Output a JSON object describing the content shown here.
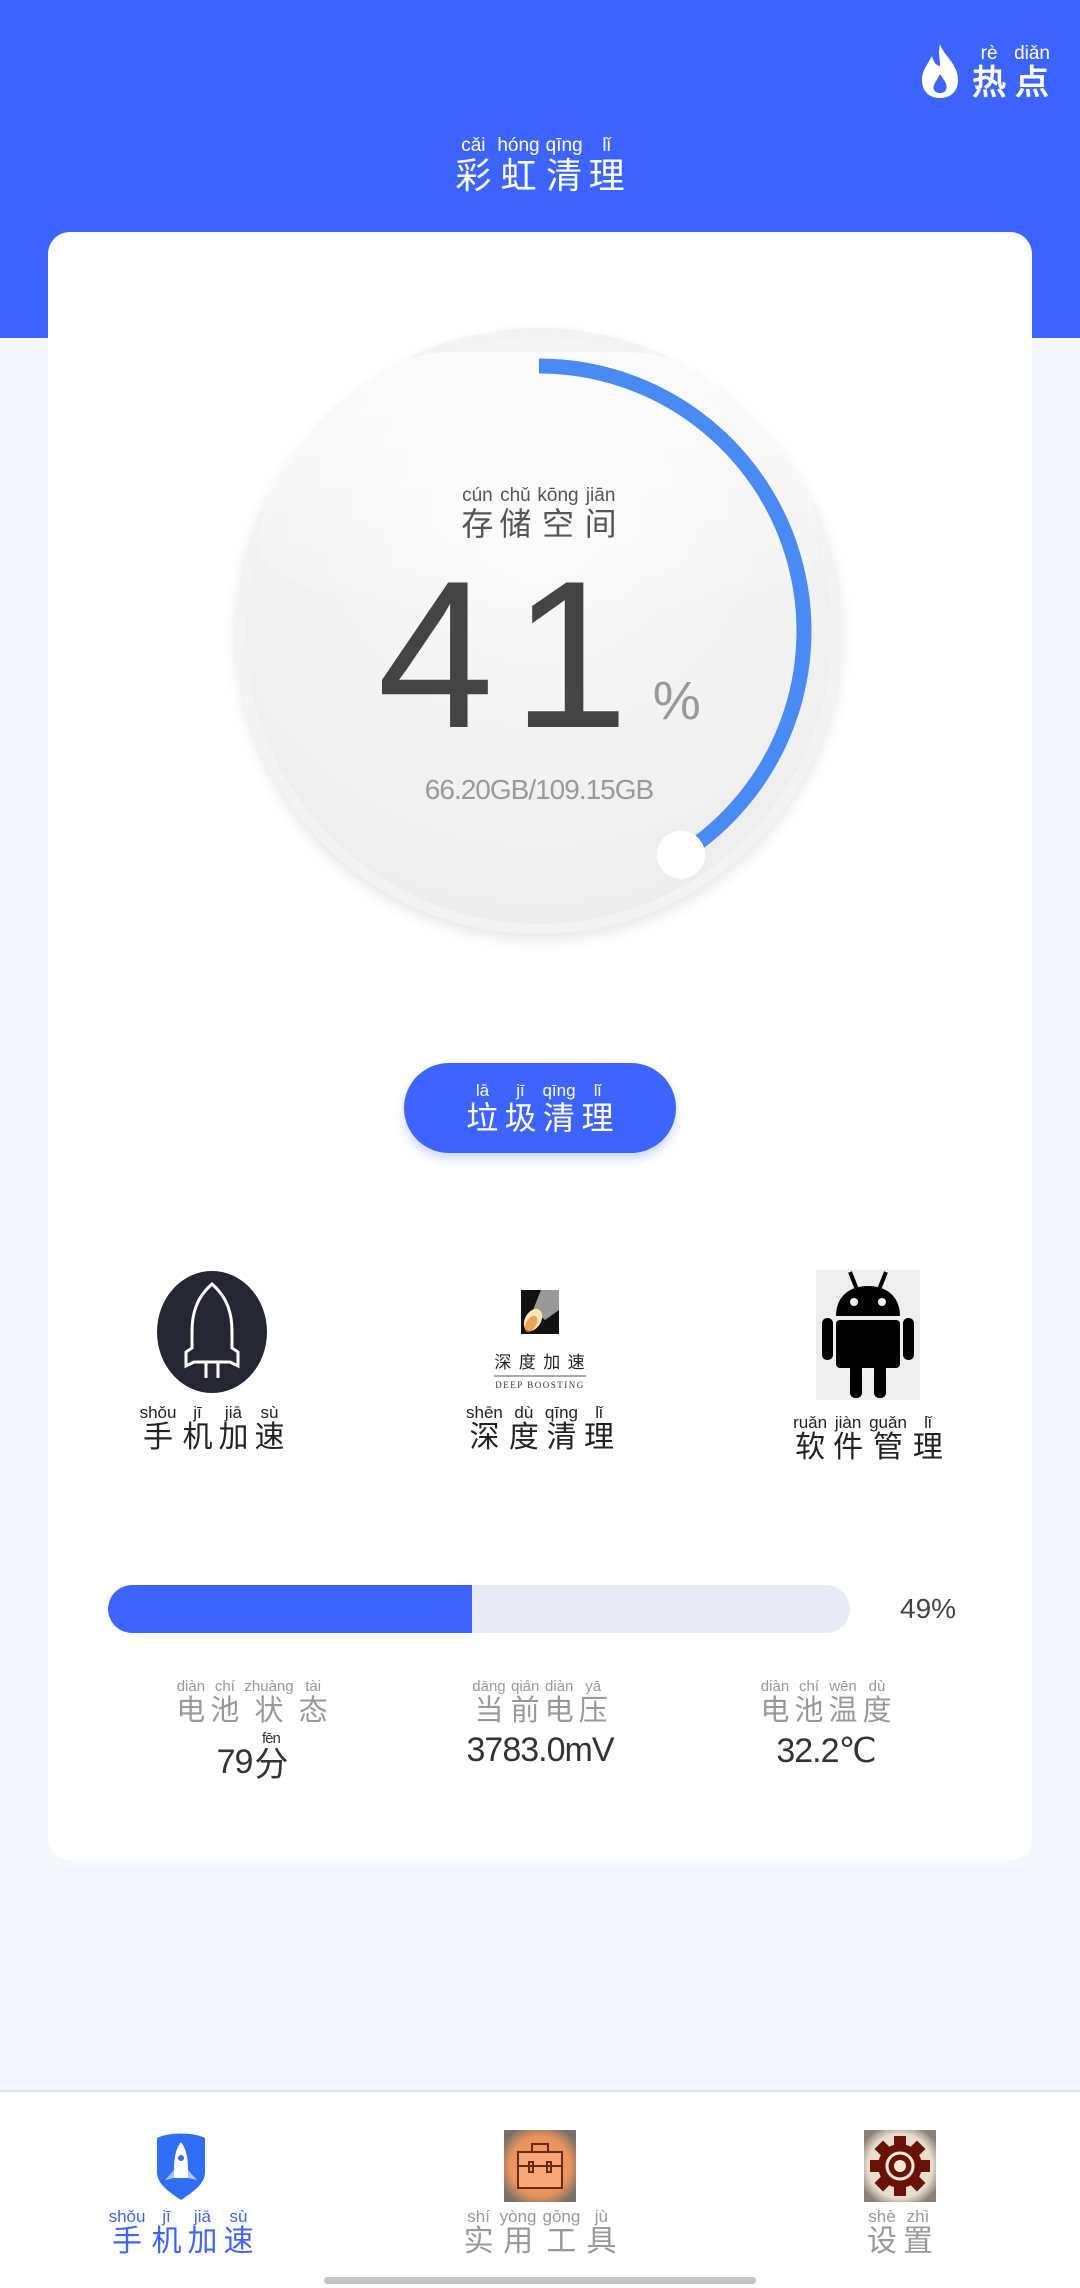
{
  "header": {
    "title": {
      "pinyin": [
        "cǎi",
        "hóng",
        "qīng",
        "lǐ"
      ],
      "hanzi": [
        "彩",
        "虹",
        "清",
        "理"
      ]
    },
    "hot": {
      "icon": "flame-icon",
      "pinyin": [
        "rè",
        "diǎn"
      ],
      "hanzi": [
        "热",
        "点"
      ]
    }
  },
  "storage": {
    "label": {
      "pinyin": [
        "cún",
        "chǔ",
        "kōng",
        "jiān"
      ],
      "hanzi": [
        "存",
        "储",
        "空",
        "间"
      ]
    },
    "percent": "41",
    "percent_sign": "%",
    "percent_value": 41,
    "used_total": "66.20GB/109.15GB",
    "accent": "#4a8af4"
  },
  "clean_button": {
    "pinyin": [
      "lā",
      "jī",
      "qīng",
      "lǐ"
    ],
    "hanzi": [
      "垃",
      "圾",
      "清",
      "理"
    ]
  },
  "features": [
    {
      "icon": "rocket-icon",
      "pinyin": [
        "shǒu",
        "jī",
        "jiā",
        "sù"
      ],
      "hanzi": [
        "手",
        "机",
        "加",
        "速"
      ]
    },
    {
      "icon": "deep-boosting-icon",
      "logo_text": "深 度 加 速",
      "logo_sub": "DEEP BOOSTING",
      "pinyin": [
        "shēn",
        "dù",
        "qīng",
        "lǐ"
      ],
      "hanzi": [
        "深",
        "度",
        "清",
        "理"
      ]
    },
    {
      "icon": "android-icon",
      "pinyin": [
        "ruǎn",
        "jiàn",
        "guǎn",
        "lǐ"
      ],
      "hanzi": [
        "软",
        "件",
        "管",
        "理"
      ]
    }
  ],
  "battery": {
    "level_percent": 49,
    "level_text": "49%",
    "stats": [
      {
        "pinyin": [
          "diàn",
          "chí",
          "zhuàng",
          "tài"
        ],
        "hanzi": [
          "电",
          "池",
          "状",
          "态"
        ],
        "value": "79",
        "unit_pinyin": "fēn",
        "unit_hanzi": "分"
      },
      {
        "pinyin": [
          "dāng",
          "qián",
          "diàn",
          "yā"
        ],
        "hanzi": [
          "当",
          "前",
          "电",
          "压"
        ],
        "value": "3783.0mV"
      },
      {
        "pinyin": [
          "diàn",
          "chí",
          "wēn",
          "dù"
        ],
        "hanzi": [
          "电",
          "池",
          "温",
          "度"
        ],
        "value": "32.2℃"
      }
    ]
  },
  "bottom_nav": [
    {
      "icon": "rocket-shield-icon",
      "pinyin": [
        "shǒu",
        "jī",
        "jiā",
        "sù"
      ],
      "hanzi": [
        "手",
        "机",
        "加",
        "速"
      ],
      "active": true
    },
    {
      "icon": "toolbox-icon",
      "pinyin": [
        "shí",
        "yòng",
        "gōng",
        "jù"
      ],
      "hanzi": [
        "实",
        "用",
        "工",
        "具"
      ],
      "active": false
    },
    {
      "icon": "gear-icon",
      "pinyin": [
        "shè",
        "zhì"
      ],
      "hanzi": [
        "设",
        "置"
      ],
      "active": false
    }
  ],
  "colors": {
    "primary": "#3e64ff",
    "background": "#f5f7fd",
    "track": "#e8ebf3"
  }
}
